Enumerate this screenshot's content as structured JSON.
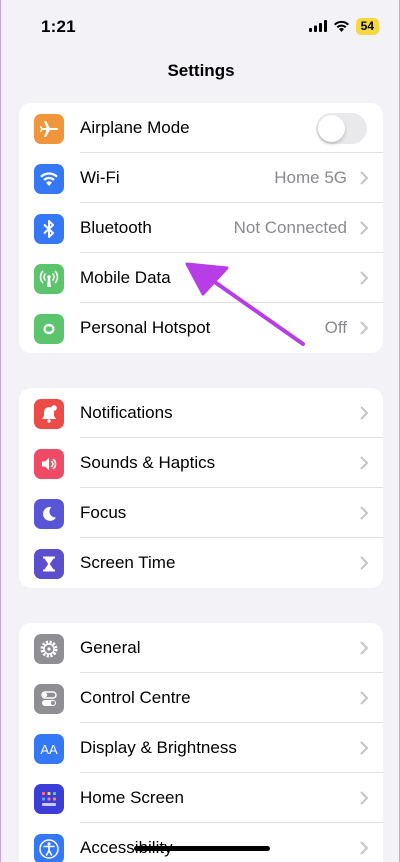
{
  "status_bar": {
    "time": "1:21",
    "battery": "54"
  },
  "nav": {
    "title": "Settings"
  },
  "colors": {
    "orange": "#f0953a",
    "blue": "#3478f6",
    "green": "#5cc46d",
    "red": "#ec4b47",
    "pink": "#ee4b67",
    "indigo": "#5856d6",
    "purple": "#5b4fcf",
    "gray": "#8e8e93",
    "arrow": "#b73ee6"
  },
  "group1": [
    {
      "label": "Airplane Mode",
      "icon": "airplane-icon",
      "toggle": false
    },
    {
      "label": "Wi-Fi",
      "value": "Home 5G",
      "icon": "wifi-icon"
    },
    {
      "label": "Bluetooth",
      "value": "Not Connected",
      "icon": "bluetooth-icon"
    },
    {
      "label": "Mobile Data",
      "icon": "antenna-icon"
    },
    {
      "label": "Personal Hotspot",
      "value": "Off",
      "icon": "hotspot-icon"
    }
  ],
  "group2": [
    {
      "label": "Notifications",
      "icon": "bell-icon"
    },
    {
      "label": "Sounds & Haptics",
      "icon": "speaker-icon"
    },
    {
      "label": "Focus",
      "icon": "moon-icon"
    },
    {
      "label": "Screen Time",
      "icon": "hourglass-icon"
    }
  ],
  "group3": [
    {
      "label": "General",
      "icon": "gear-icon"
    },
    {
      "label": "Control Centre",
      "icon": "toggles-icon"
    },
    {
      "label": "Display & Brightness",
      "icon": "text-size-icon",
      "glyph": "AA"
    },
    {
      "label": "Home Screen",
      "icon": "grid-icon"
    },
    {
      "label": "Accessibility",
      "icon": "accessibility-icon"
    }
  ]
}
